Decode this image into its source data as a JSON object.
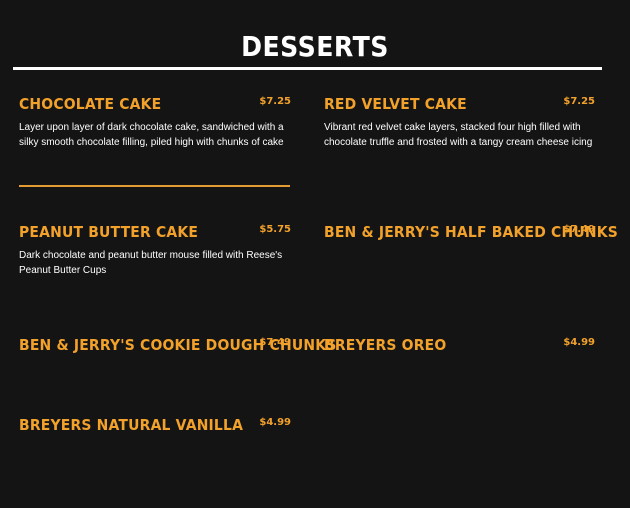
{
  "page": {
    "title": "DESSERTS"
  },
  "menu": {
    "items": [
      {
        "name": "CHOCOLATE CAKE",
        "price": "$7.25",
        "description": "Layer upon layer of dark chocolate cake, sandwiched with a silky smooth chocolate filling, piled high with chunks of cake"
      },
      {
        "name": "RED VELVET CAKE",
        "price": "$7.25",
        "description": "Vibrant red velvet cake layers, stacked four high filled with chocolate truffle and frosted with a tangy cream cheese icing"
      },
      {
        "name": "PEANUT BUTTER CAKE",
        "price": "$5.75",
        "description": "Dark chocolate and peanut butter mouse filled with Reese's Peanut Butter Cups"
      },
      {
        "name": "BEN & JERRY'S HALF BAKED CHUNKS",
        "price": "$7.49",
        "description": ""
      },
      {
        "name": "BEN & JERRY'S COOKIE DOUGH CHUNKS",
        "price": "$7.49",
        "description": ""
      },
      {
        "name": "BREYERS OREO",
        "price": "$4.99",
        "description": ""
      },
      {
        "name": "BREYERS NATURAL VANILLA",
        "price": "$4.99",
        "description": ""
      }
    ]
  },
  "colors": {
    "background": "#141414",
    "accent": "#f2a12a",
    "text": "#ffffff"
  }
}
